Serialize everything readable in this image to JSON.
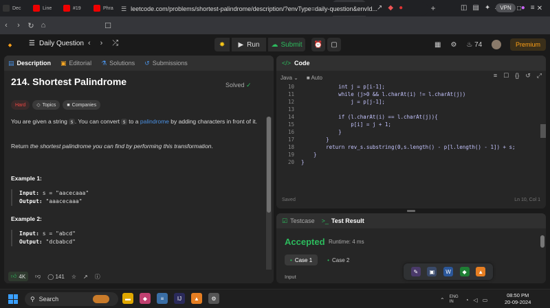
{
  "browser": {
    "tabs": [
      {
        "label": "Dec",
        "icon": "github-icon",
        "color": "#333"
      },
      {
        "label": "Line",
        "icon": "youtube-icon",
        "color": "#e00"
      },
      {
        "label": "#19",
        "icon": "youtube-icon",
        "color": "#e00"
      },
      {
        "label": "Phra",
        "icon": "youtube-icon",
        "color": "#e00"
      },
      {
        "label": "Mav",
        "icon": "maven-icon",
        "color": "#6a5acd"
      },
      {
        "label": "Sprir",
        "icon": "spring-icon",
        "color": "#6db33f"
      },
      {
        "label": "Link",
        "icon": "chatgpt-icon",
        "color": "#444"
      },
      {
        "label": "(25)",
        "icon": "linkedin-icon",
        "color": "#0a66c2"
      },
      {
        "label": "Bang",
        "icon": "bang-icon",
        "color": "#f5a623"
      },
      {
        "label": "Java",
        "icon": "java-icon",
        "color": "#2a6ebb"
      },
      {
        "label": "MbC",
        "icon": "mbc-icon",
        "color": "#888"
      },
      {
        "label": "",
        "icon": "leetcode-icon",
        "color": "#f89f1b"
      },
      {
        "label": "Striv",
        "icon": "striver-icon",
        "color": "#d32f2f"
      }
    ],
    "newtab_label": "New Tab",
    "url": "leetcode.com/problems/shortest-palindrome/description/?envType=daily-question&envId...",
    "vpn_label": "VPN"
  },
  "header": {
    "daily_label": "Daily Question",
    "run_label": "Run",
    "submit_label": "Submit",
    "streak_count": "74",
    "premium_label": "Premium"
  },
  "left": {
    "tabs": [
      {
        "label": "Description",
        "icon": "▤"
      },
      {
        "label": "Editorial",
        "icon": "▣"
      },
      {
        "label": "Solutions",
        "icon": "⚗"
      },
      {
        "label": "Submissions",
        "icon": "↺"
      }
    ],
    "title": "214. Shortest Palindrome",
    "solved_label": "Solved",
    "difficulty": "Hard",
    "topics_label": "Topics",
    "companies_label": "Companies",
    "desc_1": "You are given a string",
    "desc_var": "s",
    "desc_2": ". You can convert",
    "desc_3": "to a",
    "desc_link": "palindrome",
    "desc_4": "by adding characters in front of it.",
    "return_1": "Return",
    "return_em": "the shortest palindrome you can find by performing this transformation",
    "return_2": ".",
    "examples": [
      {
        "header": "Example 1:",
        "input_label": "Input:",
        "input": "s = \"aacecaaa\"",
        "output_label": "Output:",
        "output": "\"aaacecaaa\""
      },
      {
        "header": "Example 2:",
        "input_label": "Input:",
        "input": "s = \"abcd\"",
        "output_label": "Output:",
        "output": "\"dcbabcd\""
      }
    ],
    "likes": "4K",
    "comments": "141"
  },
  "code": {
    "tab_label": "Code",
    "language": "Java",
    "auto_label": "Auto",
    "lines": [
      {
        "n": "10",
        "t": "            int j = p[i-1];"
      },
      {
        "n": "11",
        "t": "            while (j>0 && l.charAt(i) != l.charAt(j))"
      },
      {
        "n": "12",
        "t": "                j = p[j-1];"
      },
      {
        "n": "13",
        "t": ""
      },
      {
        "n": "14",
        "t": "            if (l.charAt(i) == l.charAt(j)){"
      },
      {
        "n": "15",
        "t": "                p[i] = j + 1;"
      },
      {
        "n": "16",
        "t": "            }"
      },
      {
        "n": "17",
        "t": "        }"
      },
      {
        "n": "18",
        "t": "        return rev_s.substring(0,s.length() - p[l.length() - 1]) + s;"
      },
      {
        "n": "19",
        "t": "    }"
      },
      {
        "n": "20",
        "t": "}"
      }
    ],
    "saved_label": "Saved",
    "cursor_pos": "Ln 10, Col 1"
  },
  "test": {
    "testcase_label": "Testcase",
    "result_label": "Test Result",
    "status": "Accepted",
    "runtime": "Runtime: 4 ms",
    "cases": [
      "Case 1",
      "Case 2"
    ],
    "input_label": "Input"
  },
  "taskbar": {
    "search_label": "Search",
    "time": "08:50 PM",
    "date": "20-09-2024",
    "lang": "ENG IN"
  }
}
